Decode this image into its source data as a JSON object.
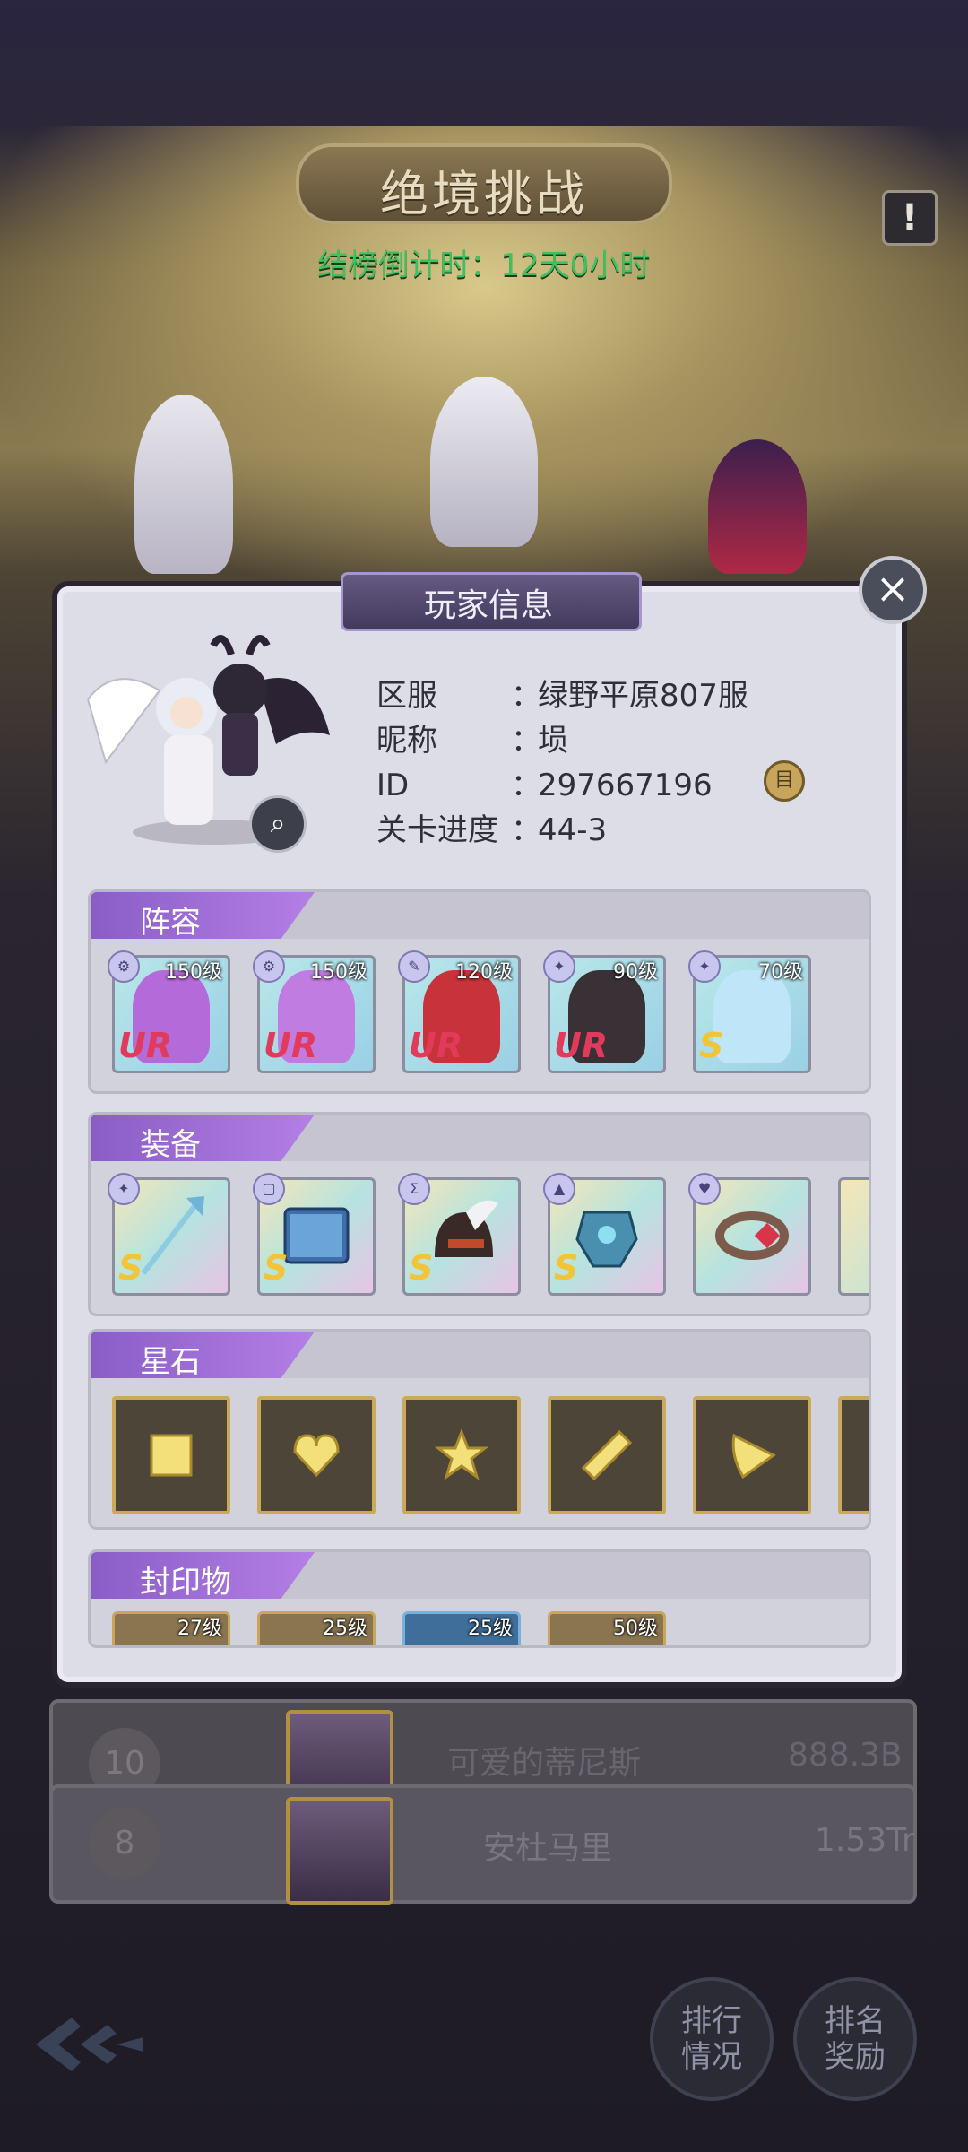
{
  "event": {
    "title": "绝境挑战",
    "countdown": "结榜倒计时：12天0小时",
    "info_icon": "!"
  },
  "rankings": [
    {
      "rank": "10",
      "name": "可爱的蒂尼斯",
      "score": "888.3B"
    },
    {
      "rank": "8",
      "name": "安杜马里",
      "score": "1.53Tr"
    }
  ],
  "bottom": {
    "ranking_status_label": "排行\n情况",
    "ranking_reward_label": "排名\n奖励"
  },
  "popup": {
    "title": "玩家信息",
    "close_icon": "×",
    "info": [
      {
        "label": "区服",
        "value": "绿野平原807服"
      },
      {
        "label": "昵称",
        "value": "埙"
      },
      {
        "label": "ID",
        "value": "297667196"
      },
      {
        "label": "关卡进度",
        "value": "44-3"
      }
    ],
    "copy_icon": "目",
    "sections": {
      "lineup": {
        "title": "阵容",
        "heroes": [
          {
            "level": "150级",
            "grade": "UR",
            "hair": "#b46ad8"
          },
          {
            "level": "150级",
            "grade": "UR",
            "hair": "#c07ce0"
          },
          {
            "level": "120级",
            "grade": "UR",
            "hair": "#c8323a"
          },
          {
            "level": "90级",
            "grade": "UR",
            "hair": "#3a3136"
          },
          {
            "level": "70级",
            "grade": "S",
            "hair": "#bfe6f8"
          }
        ]
      },
      "equipment": {
        "title": "装备",
        "items": [
          {
            "name": "trident-icon",
            "grade": "S"
          },
          {
            "name": "book-icon",
            "grade": "S"
          },
          {
            "name": "helmet-icon",
            "grade": "S"
          },
          {
            "name": "armor-icon",
            "grade": "S"
          },
          {
            "name": "bracelet-icon",
            "grade": ""
          }
        ]
      },
      "stones": {
        "title": "星石",
        "items": [
          "square-gem-icon",
          "heart-gem-icon",
          "star-gem-icon",
          "diamond-gem-icon",
          "triangle-gem-icon"
        ]
      },
      "seals": {
        "title": "封印物",
        "levels": [
          "27级",
          "25级",
          "25级",
          "50级"
        ]
      }
    }
  },
  "colors": {
    "accent_purple": "#9f6ad8",
    "ur_text": "#e23a5a",
    "s_text": "#f2c43a",
    "countdown_green": "#40c060"
  }
}
